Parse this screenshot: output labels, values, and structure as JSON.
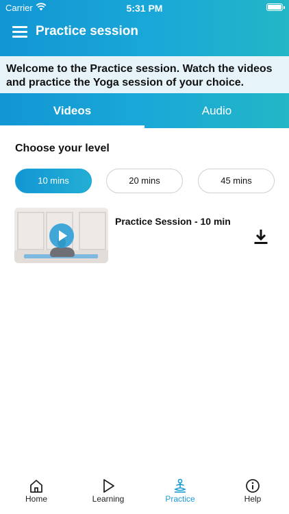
{
  "status_bar": {
    "carrier": "Carrier",
    "time": "5:31 PM"
  },
  "header": {
    "title": "Practice session"
  },
  "welcome": {
    "text": "Welcome to the Practice session. Watch the videos and practice the Yoga session of your choice."
  },
  "tabs": [
    {
      "label": "Videos",
      "active": true
    },
    {
      "label": "Audio",
      "active": false
    }
  ],
  "level": {
    "title": "Choose your level",
    "options": [
      {
        "label": "10 mins",
        "selected": true
      },
      {
        "label": "20 mins",
        "selected": false
      },
      {
        "label": "45 mins",
        "selected": false
      }
    ]
  },
  "videos": [
    {
      "title": "Practice Session - 10 min",
      "icon": "download-icon"
    }
  ],
  "tab_bar": {
    "items": [
      {
        "label": "Home",
        "icon": "home-icon"
      },
      {
        "label": "Learning",
        "icon": "play-outline-icon"
      },
      {
        "label": "Practice",
        "icon": "meditation-icon",
        "active": true
      },
      {
        "label": "Help",
        "icon": "info-icon"
      }
    ]
  },
  "colors": {
    "accent": "#1a9ad6",
    "accent_end": "#23b6c6",
    "welcome_bg": "#e6f4fa"
  }
}
